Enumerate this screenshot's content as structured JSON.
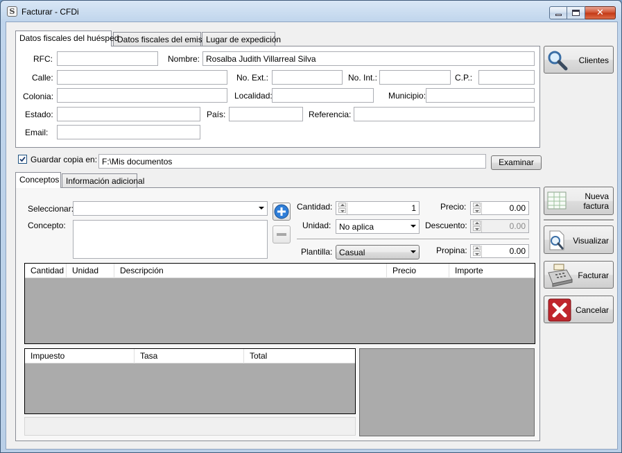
{
  "window": {
    "title": "Facturar - CFDi",
    "icon": "app-s-icon"
  },
  "top_tabs": [
    {
      "label": "Datos fiscales del huésped",
      "active": true
    },
    {
      "label": "Datos fiscales del emisor",
      "active": false
    },
    {
      "label": "Lugar de expedición",
      "active": false
    }
  ],
  "guest": {
    "rfc_label": "RFC:",
    "rfc_value": "",
    "nombre_label": "Nombre:",
    "nombre_value": "Rosalba Judith Villarreal Silva",
    "calle_label": "Calle:",
    "calle_value": "",
    "noext_label": "No. Ext.:",
    "noext_value": "",
    "noint_label": "No. Int.:",
    "noint_value": "",
    "cp_label": "C.P.:",
    "cp_value": "",
    "colonia_label": "Colonia:",
    "colonia_value": "",
    "localidad_label": "Localidad:",
    "localidad_value": "",
    "municipio_label": "Municipio:",
    "municipio_value": "",
    "estado_label": "Estado:",
    "estado_value": "",
    "pais_label": "País:",
    "pais_value": "",
    "referencia_label": "Referencia:",
    "referencia_value": "",
    "email_label": "Email:",
    "email_value": ""
  },
  "save_copy": {
    "checked": true,
    "label": "Guardar copia en:",
    "path": "F:\\Mis documentos",
    "browse_label": "Examinar"
  },
  "bottom_tabs": [
    {
      "label": "Conceptos",
      "active": true
    },
    {
      "label": "Información adicional",
      "active": false
    }
  ],
  "concepts": {
    "seleccionar_label": "Seleccionar:",
    "seleccionar_value": "",
    "concepto_label": "Concepto:",
    "concepto_value": "",
    "cantidad_label": "Cantidad:",
    "cantidad_value": "1",
    "precio_label": "Precio:",
    "precio_value": "0.00",
    "unidad_label": "Unidad:",
    "unidad_value": "No aplica",
    "descuento_label": "Descuento:",
    "descuento_value": "0.00",
    "plantilla_label": "Plantilla:",
    "plantilla_value": "Casual",
    "propina_label": "Propina:",
    "propina_value": "0.00"
  },
  "items_table": {
    "columns": [
      "Cantidad",
      "Unidad",
      "Descripción",
      "Precio",
      "Importe"
    ]
  },
  "tax_table": {
    "columns": [
      "Impuesto",
      "Tasa",
      "Total"
    ]
  },
  "side_buttons": {
    "clientes": "Clientes",
    "nueva_factura_1": "Nueva",
    "nueva_factura_2": "factura",
    "visualizar": "Visualizar",
    "facturar": "Facturar",
    "cancelar": "Cancelar"
  },
  "colors": {
    "accent": "#1a73c8",
    "danger": "#c0262d",
    "grid_bg": "#ababab"
  }
}
